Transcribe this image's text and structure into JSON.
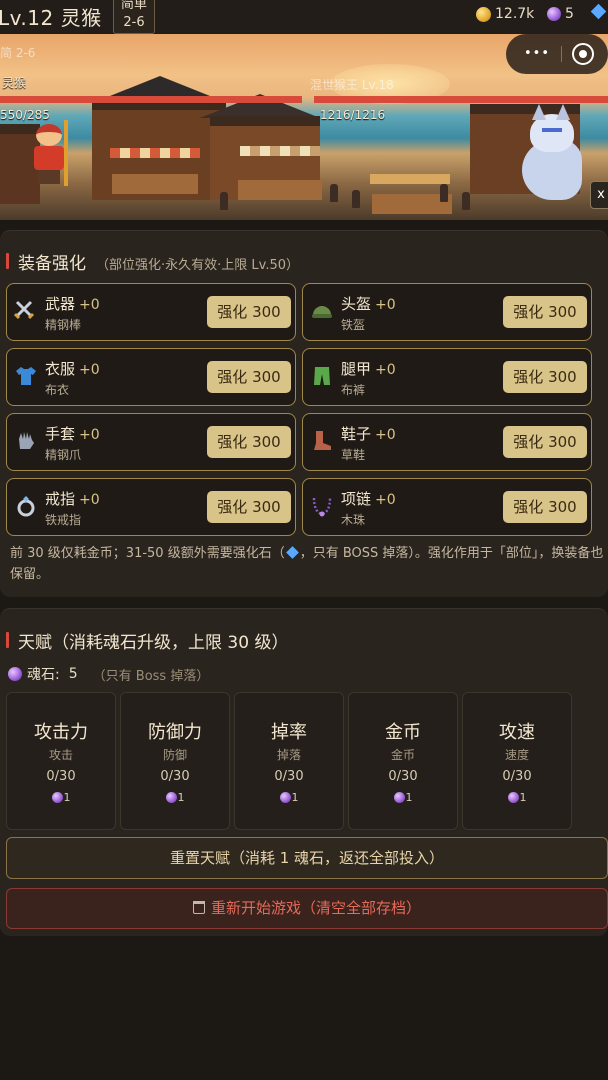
{
  "header": {
    "level_title": "Lv.12 灵猴",
    "difficulty_line1": "简单",
    "difficulty_line2": "2-6",
    "gold": "12.7k",
    "soul_stones": "5"
  },
  "battle": {
    "stage_label": "简 2-6",
    "player_name": "灵猴",
    "player_hp": "550/285",
    "boss_name": "混世猴王 Lv.18",
    "boss_hp": "1216/1216",
    "close_label": "x",
    "capsule_dots": "•••"
  },
  "equip": {
    "title": "装备强化",
    "subtitle": "（部位强化·永久有效·上限 Lv.50）",
    "slots": [
      {
        "name": "武器",
        "level": "+0",
        "item": "精钢棒",
        "button": "强化 300",
        "icon": "sword-icon"
      },
      {
        "name": "头盔",
        "level": "+0",
        "item": "铁盔",
        "button": "强化 300",
        "icon": "helmet-icon"
      },
      {
        "name": "衣服",
        "level": "+0",
        "item": "布衣",
        "button": "强化 300",
        "icon": "shirt-icon"
      },
      {
        "name": "腿甲",
        "level": "+0",
        "item": "布裤",
        "button": "强化 300",
        "icon": "pants-icon"
      },
      {
        "name": "手套",
        "level": "+0",
        "item": "精钢爪",
        "button": "强化 300",
        "icon": "glove-icon"
      },
      {
        "name": "鞋子",
        "level": "+0",
        "item": "草鞋",
        "button": "强化 300",
        "icon": "boot-icon"
      },
      {
        "name": "戒指",
        "level": "+0",
        "item": "铁戒指",
        "button": "强化 300",
        "icon": "ring-icon"
      },
      {
        "name": "项链",
        "level": "+0",
        "item": "木珠",
        "button": "强化 300",
        "icon": "necklace-icon"
      }
    ],
    "note_part1": "前 30 级仅耗金币；31-50 级额外需要强化石（",
    "note_part2": "，只有 BOSS 掉落）。强化作用于「部位」，换装备也保留。"
  },
  "talent": {
    "title": "天赋（消耗魂石升级，上限 30 级）",
    "soul_label": "魂石:",
    "soul_value": "5",
    "soul_hint": "（只有 Boss 掉落）",
    "items": [
      {
        "name": "攻击力",
        "sub": "攻击",
        "level": "0/30",
        "cost": "1"
      },
      {
        "name": "防御力",
        "sub": "防御",
        "level": "0/30",
        "cost": "1"
      },
      {
        "name": "掉率",
        "sub": "掉落",
        "level": "0/30",
        "cost": "1"
      },
      {
        "name": "金币",
        "sub": "金币",
        "level": "0/30",
        "cost": "1"
      },
      {
        "name": "攻速",
        "sub": "速度",
        "level": "0/30",
        "cost": "1"
      }
    ],
    "reset_button": "重置天赋（消耗 1 魂石，返还全部投入）",
    "restart_button": "重新开始游戏（清空全部存档）"
  },
  "colors": {
    "accent_gold": "#d8c389",
    "hp_red": "#d84a3a",
    "danger": "#e56a58"
  }
}
